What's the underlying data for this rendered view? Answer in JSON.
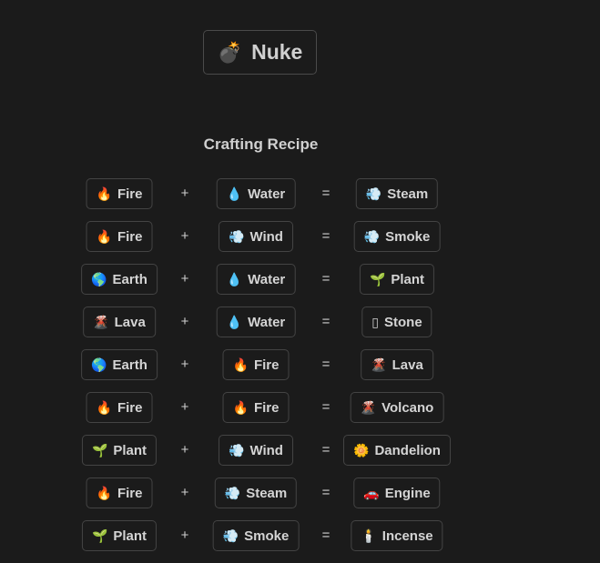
{
  "result": {
    "emoji": "💣",
    "label": "Nuke"
  },
  "heading": "Crafting Recipe",
  "operators": {
    "plus": "+",
    "equals": "="
  },
  "recipes": [
    {
      "a": {
        "emoji": "🔥",
        "label": "Fire"
      },
      "b": {
        "emoji": "💧",
        "label": "Water"
      },
      "result": {
        "emoji": "💨",
        "label": "Steam"
      }
    },
    {
      "a": {
        "emoji": "🔥",
        "label": "Fire"
      },
      "b": {
        "emoji": "💨",
        "label": "Wind"
      },
      "result": {
        "emoji": "💨",
        "label": "Smoke"
      }
    },
    {
      "a": {
        "emoji": "🌎",
        "label": "Earth"
      },
      "b": {
        "emoji": "💧",
        "label": "Water"
      },
      "result": {
        "emoji": "🌱",
        "label": "Plant"
      }
    },
    {
      "a": {
        "emoji": "🌋",
        "label": "Lava"
      },
      "b": {
        "emoji": "💧",
        "label": "Water"
      },
      "result": {
        "emoji": "▯",
        "label": "Stone"
      }
    },
    {
      "a": {
        "emoji": "🌎",
        "label": "Earth"
      },
      "b": {
        "emoji": "🔥",
        "label": "Fire"
      },
      "result": {
        "emoji": "🌋",
        "label": "Lava"
      }
    },
    {
      "a": {
        "emoji": "🔥",
        "label": "Fire"
      },
      "b": {
        "emoji": "🔥",
        "label": "Fire"
      },
      "result": {
        "emoji": "🌋",
        "label": "Volcano"
      }
    },
    {
      "a": {
        "emoji": "🌱",
        "label": "Plant"
      },
      "b": {
        "emoji": "💨",
        "label": "Wind"
      },
      "result": {
        "emoji": "🌼",
        "label": "Dandelion"
      }
    },
    {
      "a": {
        "emoji": "🔥",
        "label": "Fire"
      },
      "b": {
        "emoji": "💨",
        "label": "Steam"
      },
      "result": {
        "emoji": "🚗",
        "label": "Engine"
      }
    },
    {
      "a": {
        "emoji": "🌱",
        "label": "Plant"
      },
      "b": {
        "emoji": "💨",
        "label": "Smoke"
      },
      "result": {
        "emoji": "🕯️",
        "label": "Incense"
      }
    }
  ]
}
